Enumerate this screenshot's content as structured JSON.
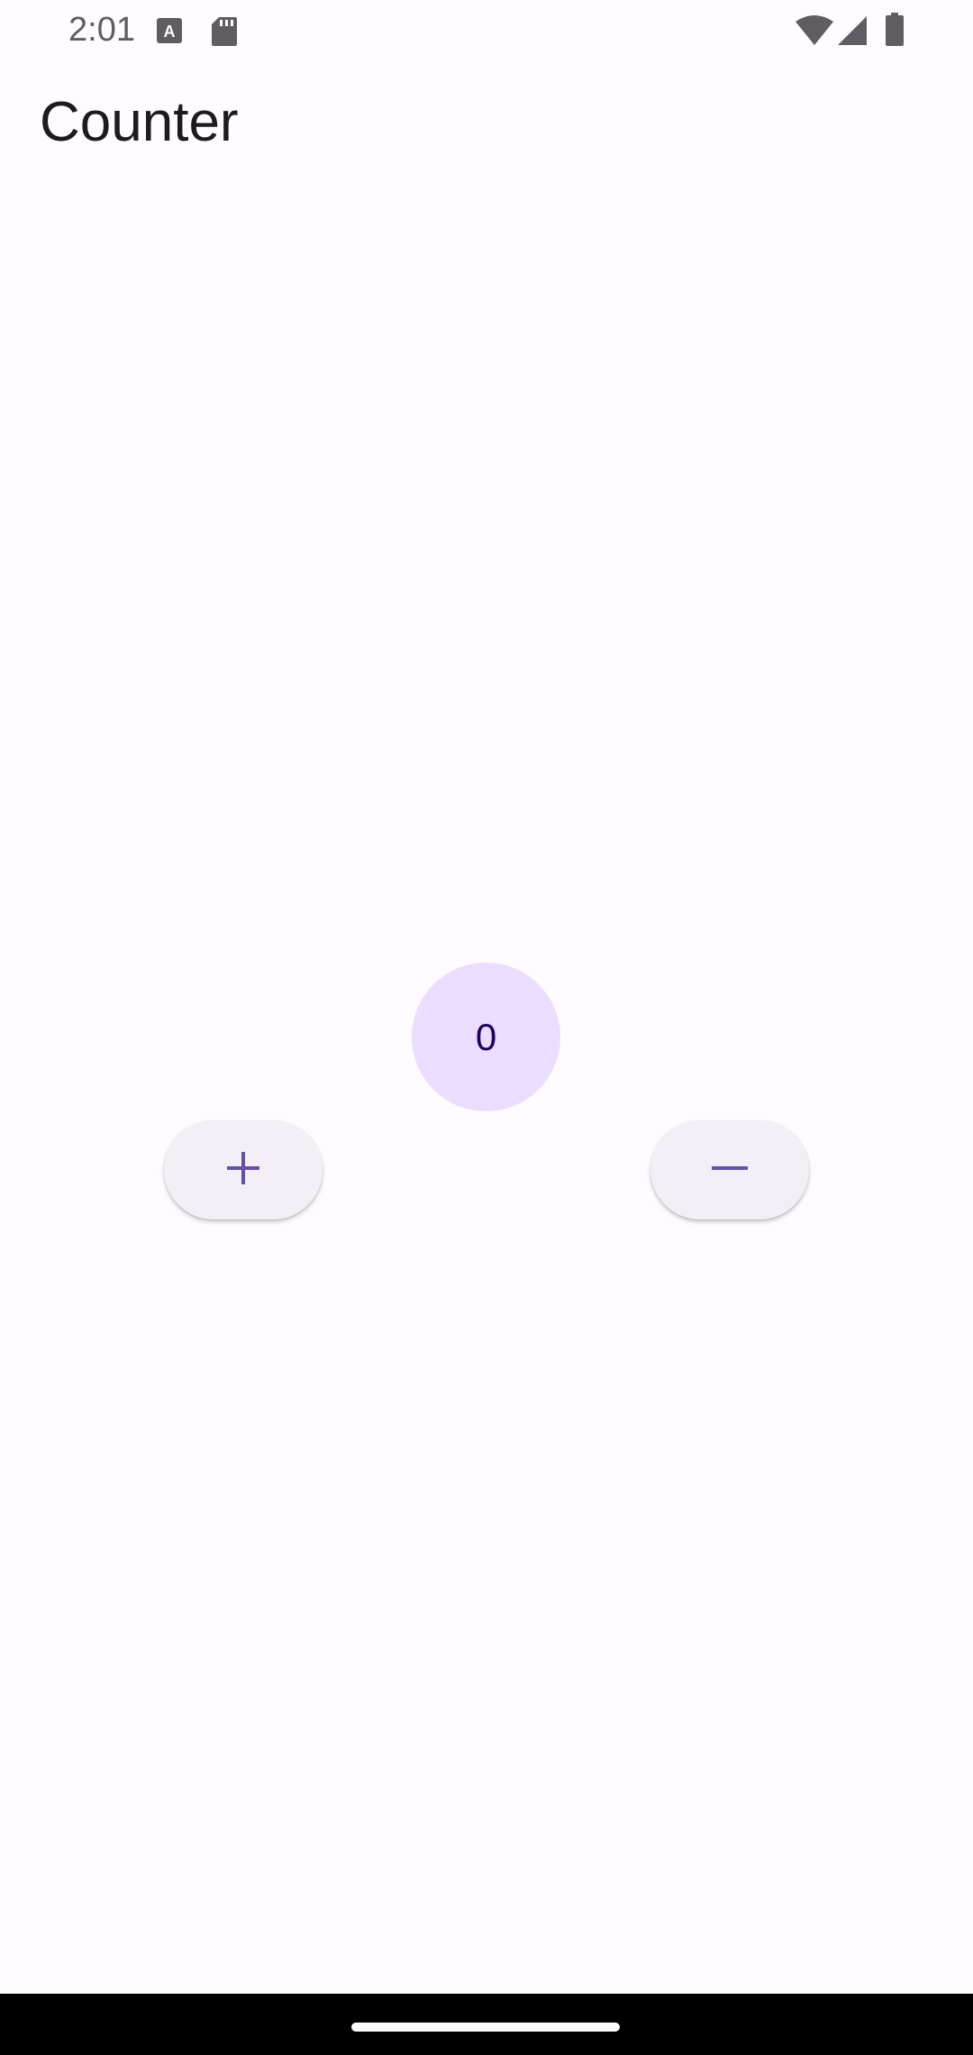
{
  "status_bar": {
    "time": "2:01",
    "left_icons": [
      "font-icon",
      "sd-card-icon"
    ],
    "right_icons": [
      "wifi-icon",
      "cell-signal-icon",
      "battery-icon"
    ]
  },
  "app_bar": {
    "title": "Counter"
  },
  "counter": {
    "value": "0"
  },
  "buttons": {
    "increment_icon": "plus-icon",
    "decrement_icon": "minus-icon"
  },
  "colors": {
    "background": "#fffbfe",
    "counter_bg": "#eaddff",
    "counter_text": "#21005d",
    "button_bg": "#f4eff7",
    "button_icon": "#6750a4"
  }
}
